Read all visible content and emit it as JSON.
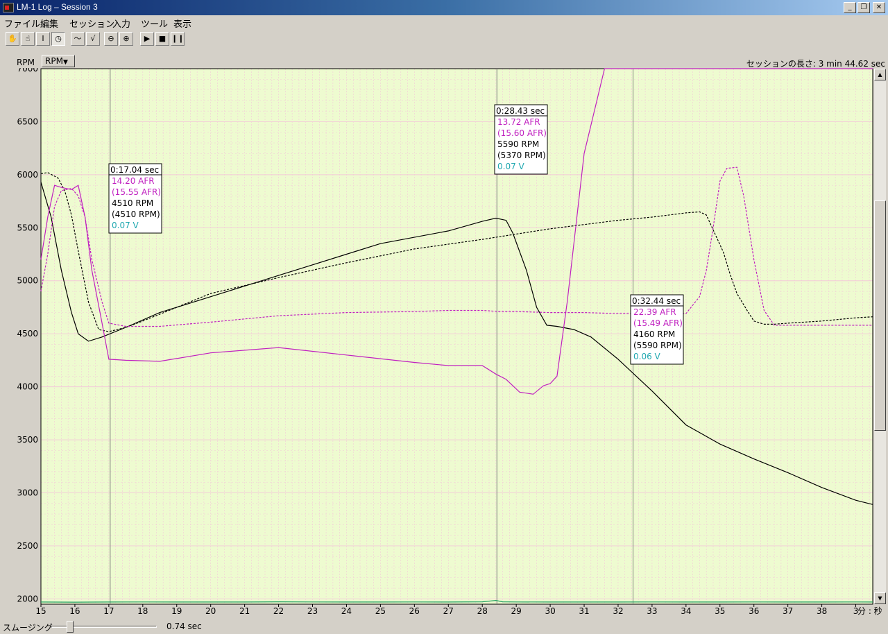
{
  "window": {
    "title": "LM-1  Log – Session 3",
    "minimize": "_",
    "restore": "❐",
    "close": "✕"
  },
  "menu": [
    "ファイル",
    "編集",
    "セッション",
    "入力",
    "ツール",
    "表示"
  ],
  "toolbar": {
    "tools": [
      {
        "name": "hand-tool-button",
        "glyph": "✋"
      },
      {
        "name": "grab-tool-button",
        "glyph": "☝"
      },
      {
        "name": "text-cursor-tool-button",
        "glyph": "I"
      },
      {
        "name": "stopwatch-tool-button",
        "glyph": "◷",
        "pressed": true
      },
      {
        "name": "smooth-line-button",
        "glyph": "〜"
      },
      {
        "name": "raw-line-button",
        "glyph": "√"
      },
      {
        "name": "zoom-out-button",
        "glyph": "⊖"
      },
      {
        "name": "zoom-in-button",
        "glyph": "⊕"
      },
      {
        "name": "play-button",
        "glyph": "▶"
      },
      {
        "name": "stop-button",
        "glyph": "■"
      },
      {
        "name": "pause-button",
        "glyph": "❙❙"
      }
    ]
  },
  "axis": {
    "y_label": "RPM",
    "y_select": "RPM",
    "session_length": "セッションの長さ:  3 min 44.62 sec",
    "x_unit": "分 : 秒"
  },
  "bottom": {
    "smoothing_label": "スムージング",
    "smoothing_value": "0.74 sec"
  },
  "colors": {
    "plot_bg": "#eefbd0",
    "grid": "#f3c9d8",
    "rpm": "#000000",
    "afr": "#c020c0",
    "volt": "#20a060"
  },
  "chart_data": {
    "type": "line",
    "xlim": [
      15,
      39.5
    ],
    "ylim": [
      1950,
      7000
    ],
    "x_ticks": [
      "15",
      "16",
      "17",
      "18",
      "19",
      "20",
      "21",
      "22",
      "23",
      "24",
      "25",
      "26",
      "27",
      "28",
      "29",
      "30",
      "31",
      "32",
      "33",
      "34",
      "35",
      "36",
      "37",
      "38",
      "3"
    ],
    "y_ticks": [
      "7000",
      "6500",
      "6000",
      "5500",
      "5000",
      "4500",
      "4000",
      "3500",
      "3000",
      "2500",
      "2000"
    ],
    "cursors": [
      17.04,
      28.43,
      32.44
    ],
    "series": [
      {
        "name": "RPM",
        "style": "solid",
        "color": "#000000",
        "x": [
          15.0,
          15.3,
          15.6,
          15.9,
          16.1,
          16.4,
          16.8,
          17.5,
          18.5,
          20,
          22,
          24,
          25,
          27,
          28,
          28.4,
          28.7,
          28.9,
          29.3,
          29.6,
          29.9,
          30.2,
          30.7,
          31.2,
          32,
          33,
          34,
          35,
          36,
          37,
          38,
          39,
          39.5
        ],
        "y": [
          5930,
          5600,
          5100,
          4700,
          4500,
          4430,
          4470,
          4560,
          4700,
          4850,
          5050,
          5250,
          5350,
          5470,
          5560,
          5590,
          5570,
          5450,
          5100,
          4750,
          4580,
          4570,
          4540,
          4470,
          4260,
          3960,
          3640,
          3460,
          3320,
          3190,
          3050,
          2930,
          2890
        ]
      },
      {
        "name": "RPM ref",
        "style": "dashed",
        "color": "#000000",
        "x": [
          15.0,
          15.2,
          15.5,
          15.7,
          15.9,
          16.1,
          16.4,
          16.7,
          17.0,
          17.5,
          18,
          19,
          20,
          22,
          24,
          26,
          28,
          30,
          32,
          33,
          34,
          34.4,
          34.6,
          34.8,
          35.1,
          35.3,
          35.5,
          35.8,
          36.0,
          36.3,
          36.6,
          37,
          38,
          39,
          39.5
        ],
        "y": [
          6010,
          6020,
          5970,
          5850,
          5620,
          5280,
          4800,
          4540,
          4520,
          4560,
          4620,
          4750,
          4880,
          5030,
          5170,
          5300,
          5390,
          5490,
          5570,
          5600,
          5640,
          5650,
          5620,
          5480,
          5270,
          5060,
          4880,
          4720,
          4620,
          4590,
          4590,
          4600,
          4620,
          4650,
          4660
        ]
      },
      {
        "name": "AFR",
        "style": "solid",
        "color": "#c020c0",
        "x": [
          15.0,
          15.2,
          15.4,
          15.6,
          15.9,
          16.1,
          16.3,
          16.5,
          16.8,
          17.0,
          17.5,
          18.5,
          20,
          22,
          24,
          26,
          27,
          28,
          28.4,
          28.7,
          28.9,
          29.1,
          29.5,
          29.8,
          30.0,
          30.2,
          30.5,
          31.0,
          31.6,
          32.0,
          33,
          34,
          35,
          36,
          37,
          38,
          39,
          39.5
        ],
        "y": [
          5200,
          5600,
          5900,
          5880,
          5860,
          5900,
          5600,
          5100,
          4600,
          4260,
          4250,
          4240,
          4320,
          4370,
          4300,
          4230,
          4200,
          4200,
          4120,
          4070,
          4010,
          3950,
          3930,
          4010,
          4030,
          4100,
          4800,
          6200,
          7000,
          7000,
          7000,
          7000,
          7000,
          7000,
          7000,
          7000,
          7000,
          7000
        ]
      },
      {
        "name": "AFR ref",
        "style": "dashed",
        "color": "#c020c0",
        "x": [
          15.0,
          15.2,
          15.4,
          15.6,
          15.9,
          16.1,
          16.3,
          16.5,
          16.8,
          17.0,
          17.5,
          18.5,
          20,
          22,
          24,
          26,
          27,
          28,
          28.5,
          29,
          30,
          31,
          32,
          33,
          34,
          34.4,
          34.6,
          34.8,
          35.0,
          35.2,
          35.5,
          35.7,
          36.0,
          36.3,
          36.6,
          37,
          38,
          39,
          39.5
        ],
        "y": [
          4900,
          5250,
          5700,
          5850,
          5870,
          5800,
          5600,
          5200,
          4800,
          4600,
          4570,
          4570,
          4610,
          4670,
          4700,
          4710,
          4720,
          4720,
          4710,
          4710,
          4700,
          4700,
          4690,
          4690,
          4690,
          4850,
          5100,
          5500,
          5940,
          6060,
          6070,
          5800,
          5200,
          4720,
          4580,
          4580,
          4580,
          4580,
          4580
        ]
      },
      {
        "name": "Volts",
        "style": "solid",
        "color": "#20a060",
        "x": [
          15,
          16,
          17,
          18,
          19,
          20,
          21,
          22,
          23,
          24,
          25,
          26,
          27,
          28,
          28.4,
          28.6,
          29,
          30,
          31,
          32,
          33,
          34,
          35,
          36,
          37,
          38,
          39,
          39.5
        ],
        "y": [
          1970,
          1969,
          1970,
          1971,
          1970,
          1970,
          1970,
          1972,
          1971,
          1970,
          1970,
          1971,
          1970,
          1972,
          1985,
          1972,
          1971,
          1970,
          1970,
          1970,
          1971,
          1970,
          1970,
          1971,
          1970,
          1970,
          1971,
          1970
        ]
      }
    ],
    "tooltips": [
      {
        "time": "0:17.04 sec",
        "afr": "14.20 AFR",
        "afr_ref": "(15.55 AFR)",
        "rpm": "4510 RPM",
        "rpm_ref": "(4510 RPM)",
        "volt": "0.07 V"
      },
      {
        "time": "0:28.43 sec",
        "afr": "13.72 AFR",
        "afr_ref": "(15.60 AFR)",
        "rpm": "5590 RPM",
        "rpm_ref": "(5370 RPM)",
        "volt": "0.07 V"
      },
      {
        "time": "0:32.44 sec",
        "afr": "22.39 AFR",
        "afr_ref": "(15.49 AFR)",
        "rpm": "4160 RPM",
        "rpm_ref": "(5590 RPM)",
        "volt": "0.06 V"
      }
    ]
  }
}
